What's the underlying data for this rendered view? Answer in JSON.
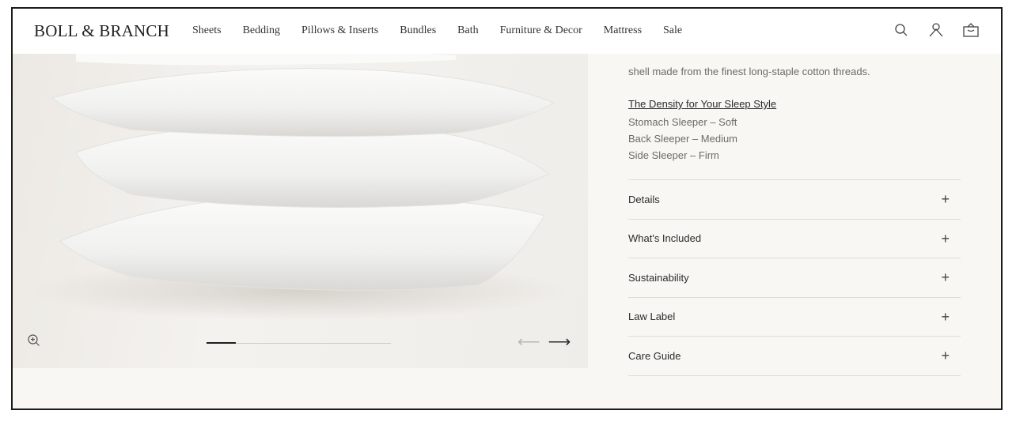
{
  "brand": {
    "logo": "BOLL & BRANCH"
  },
  "nav": {
    "items": [
      {
        "label": "Sheets"
      },
      {
        "label": "Bedding"
      },
      {
        "label": "Pillows & Inserts"
      },
      {
        "label": "Bundles"
      },
      {
        "label": "Bath"
      },
      {
        "label": "Furniture & Decor"
      },
      {
        "label": "Mattress"
      },
      {
        "label": "Sale"
      }
    ]
  },
  "header_icons": [
    "search-icon",
    "account-icon",
    "bag-icon"
  ],
  "gallery": {
    "slide_progress_fraction": 0.16,
    "icons": [
      "zoom-icon",
      "arrow-left-icon",
      "arrow-right-icon"
    ],
    "prev_arrow": "⟵",
    "next_arrow": "⟶"
  },
  "product": {
    "description_tail": "shell made from the finest long-staple cotton threads.",
    "density_link": "The Density for Your Sleep Style",
    "sleep_styles": [
      "Stomach Sleeper – Soft",
      "Back Sleeper – Medium",
      "Side Sleeper – Firm"
    ],
    "accordion": [
      {
        "label": "Details",
        "icon": "+"
      },
      {
        "label": "What's Included",
        "icon": "+"
      },
      {
        "label": "Sustainability",
        "icon": "+"
      },
      {
        "label": "Law Label",
        "icon": "+"
      },
      {
        "label": "Care Guide",
        "icon": "+"
      }
    ]
  },
  "colors": {
    "background": "#f8f7f3",
    "header": "#ffffff",
    "text": "#2b2b2b",
    "muted": "#6d6b67",
    "divider": "#dedcd7"
  }
}
